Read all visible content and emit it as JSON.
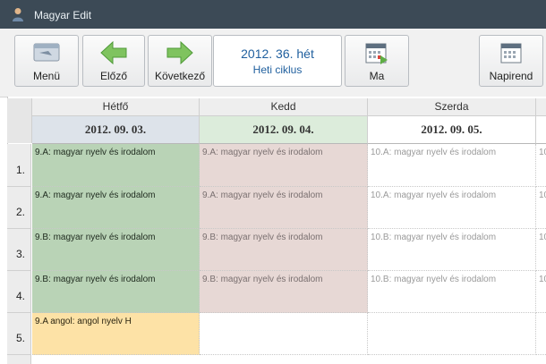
{
  "window": {
    "title": "Magyar Edit"
  },
  "toolbar": {
    "menu_label": "Menü",
    "prev_label": "Előző",
    "next_label": "Következő",
    "week_title": "2012. 36. hét",
    "week_cycle": "Heti ciklus",
    "today_label": "Ma",
    "diary_label": "Napirend"
  },
  "colors": {
    "titlebar": "#3c4a56",
    "week_text": "#1f5f9e",
    "monday_lesson": "#b9d3b6",
    "tuesday_lesson": "#e7d8d5",
    "elective_lesson": "#fde2a6",
    "monday_header": "#dde3ea",
    "tuesday_header": "#dcecdb",
    "arrow_green": "#7fc35f"
  },
  "icons": [
    "user-icon",
    "menu-card-icon",
    "arrow-left-icon",
    "arrow-right-icon",
    "calendar-today-icon",
    "calendar-icon"
  ],
  "days": [
    {
      "name": "Hétfő",
      "date": "2012. 09. 03."
    },
    {
      "name": "Kedd",
      "date": "2012. 09. 04."
    },
    {
      "name": "Szerda",
      "date": "2012. 09. 05."
    },
    {
      "name": "",
      "date": ""
    }
  ],
  "rows": [
    {
      "num": "1.",
      "cells": [
        "9.A: magyar nyelv és irodalom",
        "9.A: magyar nyelv és irodalom",
        "10.A: magyar nyelv és irodalom",
        "10"
      ]
    },
    {
      "num": "2.",
      "cells": [
        "9.A: magyar nyelv és irodalom",
        "9.A: magyar nyelv és irodalom",
        "10.A: magyar nyelv és irodalom",
        "10"
      ]
    },
    {
      "num": "3.",
      "cells": [
        "9.B: magyar nyelv és irodalom",
        "9.B: magyar nyelv és irodalom",
        "10.B: magyar nyelv és irodalom",
        "10"
      ]
    },
    {
      "num": "4.",
      "cells": [
        "9.B: magyar nyelv és irodalom",
        "9.B: magyar nyelv és irodalom",
        "10.B: magyar nyelv és irodalom",
        "10"
      ]
    },
    {
      "num": "5.",
      "cells": [
        "9.A angol: angol nyelv H",
        "",
        "",
        ""
      ]
    }
  ]
}
